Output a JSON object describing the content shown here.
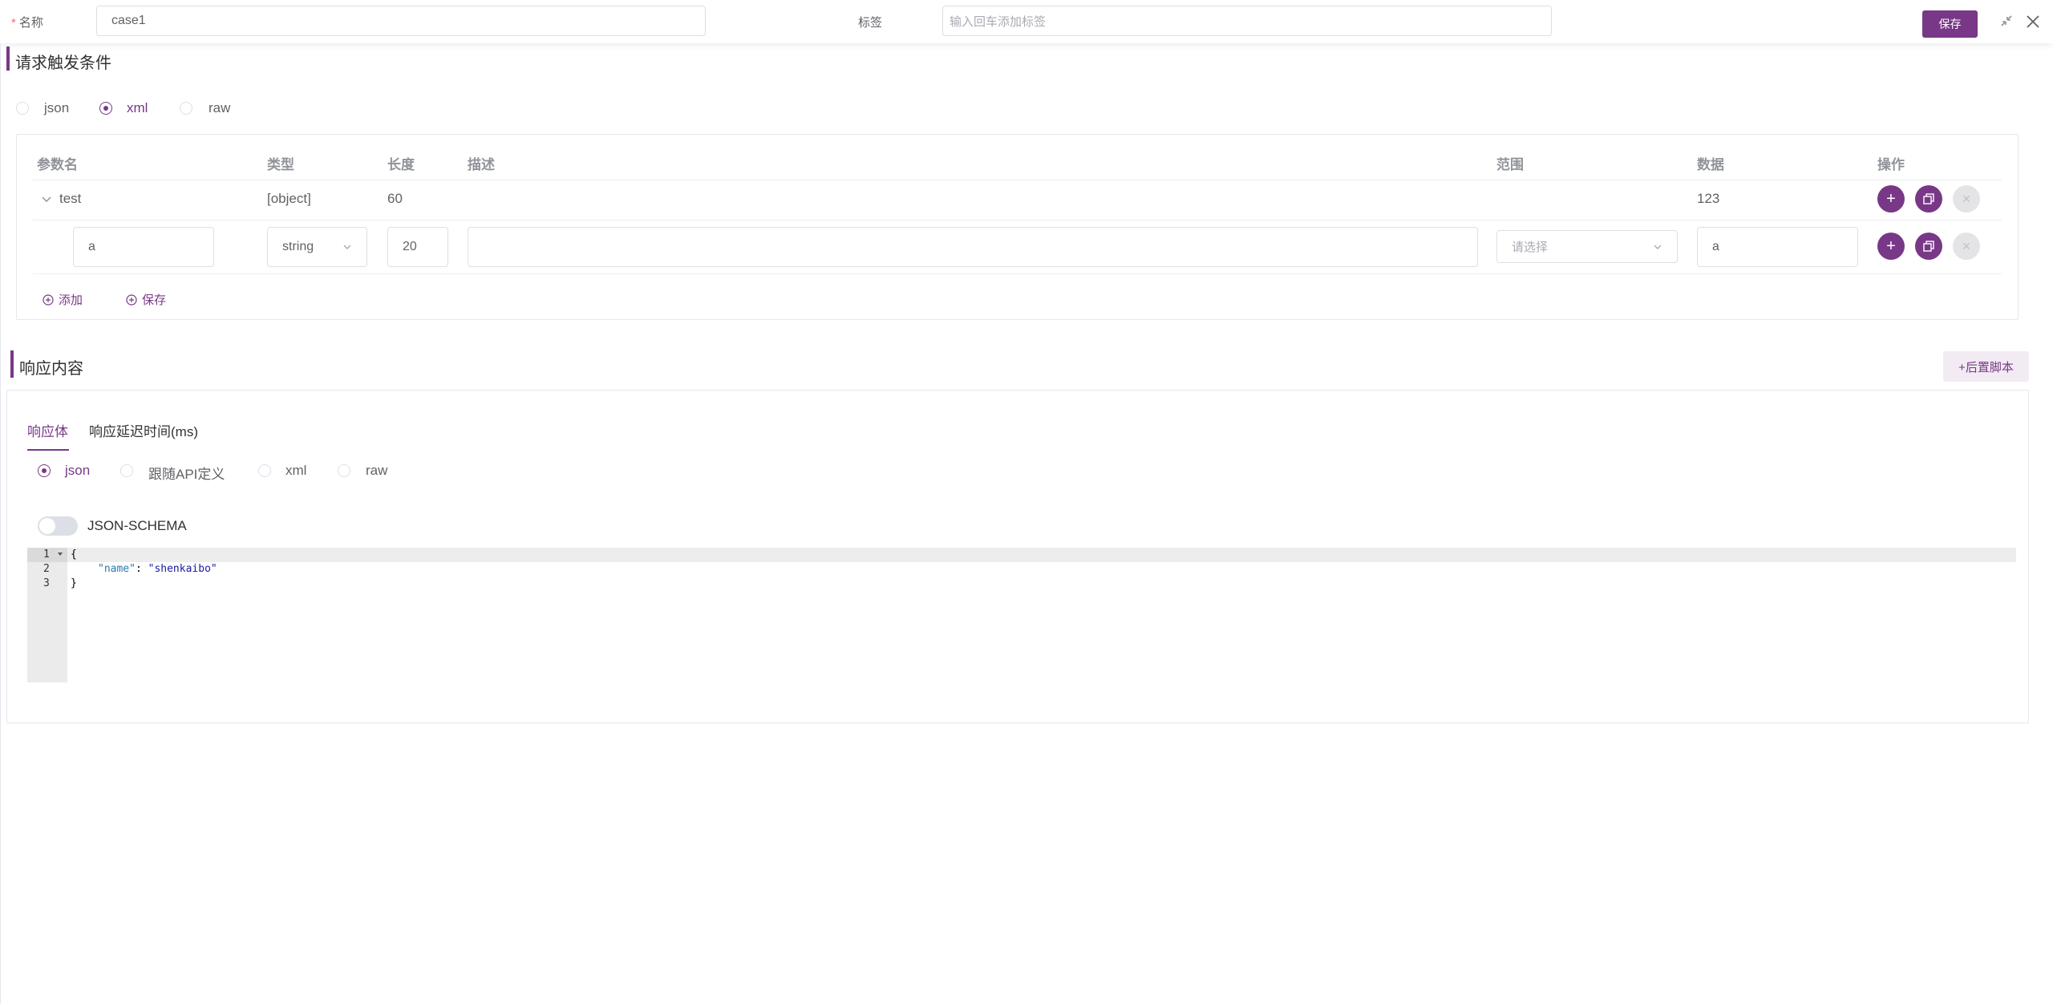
{
  "header": {
    "name_label": "名称",
    "required_mark": "*",
    "name_value": "case1",
    "tag_label": "标签",
    "tag_placeholder": "输入回车添加标签",
    "save_label": "保存",
    "colors": {
      "primary": "#783887"
    }
  },
  "request_section": {
    "title": "请求触发条件",
    "format_options": [
      "json",
      "xml",
      "raw"
    ],
    "selected_format": "xml",
    "table": {
      "headers": [
        "参数名",
        "类型",
        "长度",
        "描述",
        "范围",
        "数据",
        "操作"
      ],
      "parent_row": {
        "name": "test",
        "type": "[object]",
        "length": "60",
        "description": "",
        "range": "",
        "data": "123"
      },
      "child_row": {
        "name": "a",
        "type": "string",
        "length": "20",
        "description": "",
        "range_placeholder": "请选择",
        "data": "a"
      }
    },
    "add_label": "添加",
    "save_label": "保存"
  },
  "response_section": {
    "title": "响应内容",
    "post_script_button": "+后置脚本",
    "tabs": [
      "响应体",
      "响应延迟时间(ms)"
    ],
    "active_tab": "响应体",
    "body_format_options": [
      "json",
      "跟随API定义",
      "xml",
      "raw"
    ],
    "selected_body_format": "json",
    "json_schema_label": "JSON-SCHEMA",
    "json_schema_enabled": false,
    "code_lines": [
      {
        "num": "1",
        "text": "{"
      },
      {
        "num": "2",
        "key": "\"name\"",
        "sep": ": ",
        "value": "\"shenkaibo\""
      },
      {
        "num": "3",
        "text": "}"
      }
    ]
  }
}
